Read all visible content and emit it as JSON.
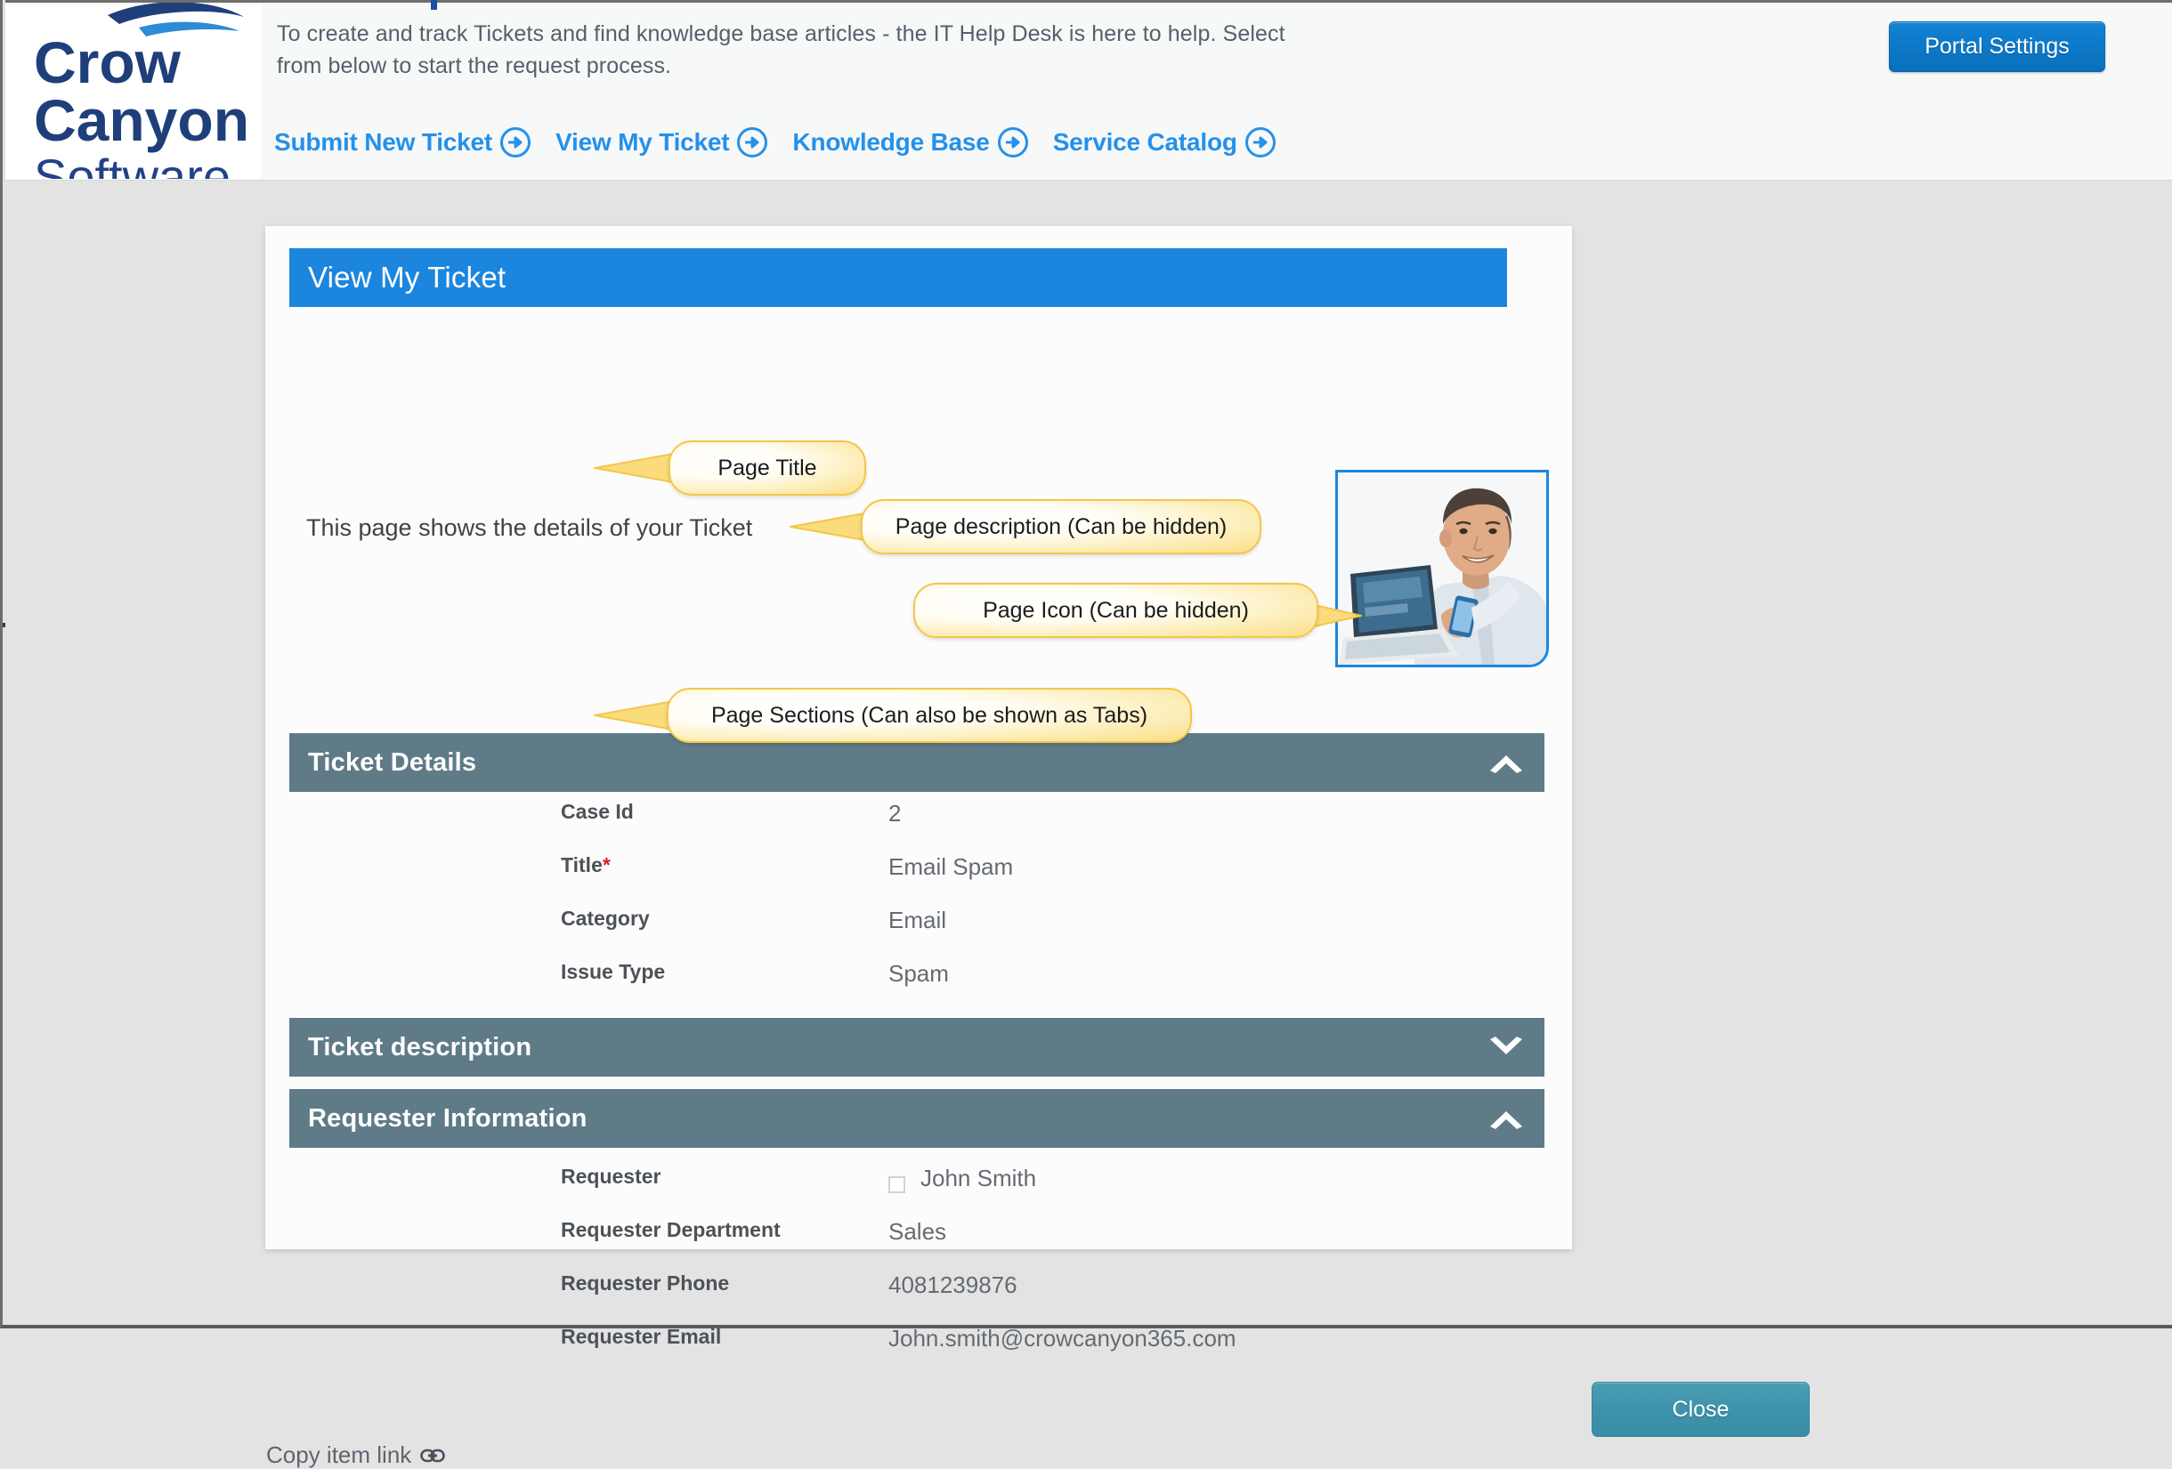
{
  "header": {
    "logo": {
      "line1": "Crow",
      "line2": "Canyon",
      "line3": "Software"
    },
    "description": "To create and track Tickets and find knowledge base articles - the IT Help Desk is here to help. Select from below to start the request process.",
    "nav_items": [
      {
        "label": "Submit New Ticket",
        "icon": "arrow-right-circle-icon"
      },
      {
        "label": "View My Ticket",
        "icon": "arrow-right-circle-icon"
      },
      {
        "label": "Knowledge Base",
        "icon": "arrow-right-circle-icon"
      },
      {
        "label": "Service Catalog",
        "icon": "arrow-right-circle-icon"
      }
    ],
    "portal_settings_label": "Portal Settings"
  },
  "page": {
    "title": "View My Ticket",
    "description": "This page shows the details of your Ticket",
    "icon_alt": "Smiling man working on a laptop"
  },
  "callouts": {
    "page_title": "Page Title",
    "page_description": "Page description (Can be hidden)",
    "page_icon": "Page Icon (Can be hidden)",
    "page_sections": "Page Sections (Can also be shown as Tabs)"
  },
  "sections": {
    "ticket_details": {
      "title": "Ticket Details",
      "state": "expanded",
      "chevron": "chevron-up-icon",
      "fields": [
        {
          "label": "Case Id",
          "required": false,
          "value": "2"
        },
        {
          "label": "Title",
          "required": true,
          "value": "Email Spam"
        },
        {
          "label": "Category",
          "required": false,
          "value": "Email"
        },
        {
          "label": "Issue Type",
          "required": false,
          "value": "Spam"
        }
      ]
    },
    "ticket_description": {
      "title": "Ticket description",
      "state": "collapsed",
      "chevron": "chevron-down-icon"
    },
    "requester_information": {
      "title": "Requester Information",
      "state": "expanded",
      "chevron": "chevron-up-icon",
      "fields": [
        {
          "label": "Requester",
          "required": false,
          "value": "John Smith",
          "checkbox": true,
          "checked": false
        },
        {
          "label": "Requester Department",
          "required": false,
          "value": "Sales"
        },
        {
          "label": "Requester Phone",
          "required": false,
          "value": "4081239876"
        },
        {
          "label": "Requester Email",
          "required": false,
          "value": "John.smith@crowcanyon365.com"
        }
      ]
    }
  },
  "actions": {
    "close_label": "Close",
    "copy_item_link_label": "Copy item link",
    "copy_item_link_icon": "link-chain-icon"
  },
  "colors": {
    "accent_blue": "#1c86de",
    "nav_blue": "#2491eb",
    "section_slate": "#5f7b88",
    "button_teal": "#3d93ab",
    "callout_border": "#f4c64b",
    "page_background": "#e3e3e3",
    "required_star": "#e02020"
  }
}
